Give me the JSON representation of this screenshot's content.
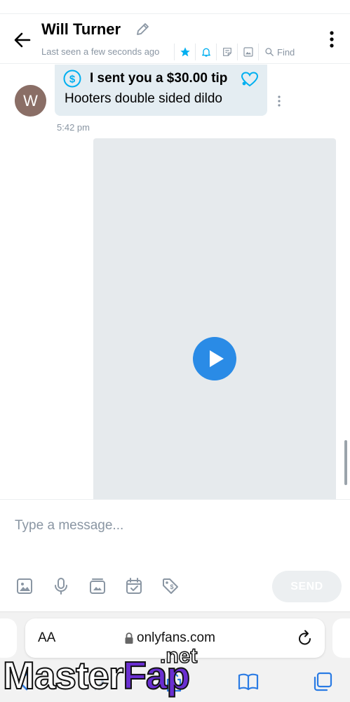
{
  "header": {
    "title": "Will Turner",
    "last_seen": "Last seen a few seconds ago",
    "find_label": "Find",
    "accent_color": "#00aff0"
  },
  "message": {
    "avatar_initial": "W",
    "tip_text": "I sent you a $30.00 tip",
    "body_text": "Hooters double sided dildo",
    "time": "5:42 pm"
  },
  "media": {
    "type": "video",
    "placeholder_note": "",
    "play_icon": "play-icon"
  },
  "composer": {
    "placeholder": "Type a message...",
    "send_label": "SEND",
    "tools": [
      "image-icon",
      "microphone-icon",
      "media-vault-icon",
      "schedule-icon",
      "price-tag-icon"
    ]
  },
  "browser": {
    "text_size_label": "AA",
    "url": "onlyfans.com"
  },
  "watermark": {
    "part_a": "Master",
    "part_b": "Fap",
    "suffix": ".net"
  }
}
